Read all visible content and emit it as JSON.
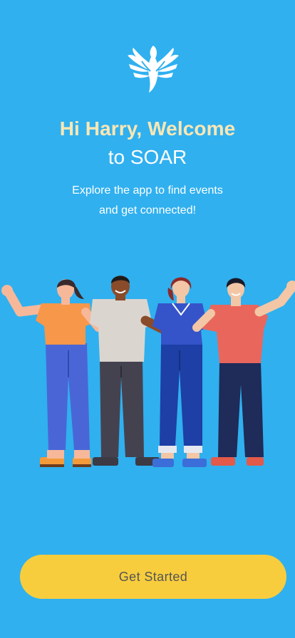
{
  "welcome": {
    "title_line1": "Hi Harry, Welcome",
    "title_line2": "to SOAR",
    "subtitle_line1": "Explore the app to find events",
    "subtitle_line2": "and get connected!"
  },
  "logo": {
    "icon": "dove-icon"
  },
  "illustration": {
    "icon": "group-of-friends-illustration"
  },
  "actions": {
    "get_started_label": "Get Started"
  },
  "colors": {
    "background": "#30b0ef",
    "title_accent": "#fbe7b5",
    "button": "#f8cd3d",
    "button_text": "#555555"
  }
}
